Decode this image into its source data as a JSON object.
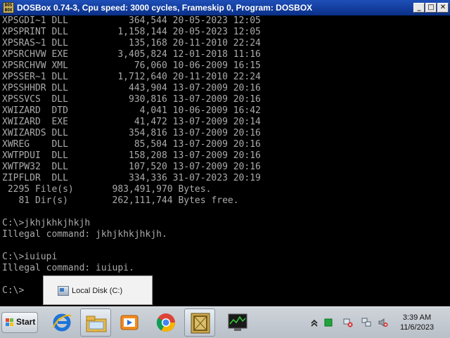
{
  "window": {
    "title": "DOSBox 0.74-3, Cpu speed:    3000 cycles, Frameskip  0, Program:   DOSBOX",
    "app_icon_text": "DOS BOX",
    "controls": {
      "minimize": "_",
      "maximize": "□",
      "close": "✕"
    }
  },
  "console": {
    "lines": [
      "XPSGDI~1 DLL           364,544 20-05-2023 12:05",
      "XPSPRINT DLL         1,158,144 20-05-2023 12:05",
      "XPSRAS~1 DLL           135,168 20-11-2010 22:24",
      "XPSRCHVW EXE         3,405,824 12-01-2018 11:16",
      "XPSRCHVW XML            76,060 10-06-2009 16:15",
      "XPSSER~1 DLL         1,712,640 20-11-2010 22:24",
      "XPSSHHDR DLL           443,904 13-07-2009 20:16",
      "XPSSVCS  DLL           930,816 13-07-2009 20:16",
      "XWIZARD  DTD             4,041 10-06-2009 16:42",
      "XWIZARD  EXE            41,472 13-07-2009 20:14",
      "XWIZARDS DLL           354,816 13-07-2009 20:16",
      "XWREG    DLL            85,504 13-07-2009 20:16",
      "XWTPDUI  DLL           158,208 13-07-2009 20:16",
      "XWTPW32  DLL           107,520 13-07-2009 20:16",
      "ZIPFLDR  DLL           334,336 31-07-2023 20:19",
      " 2295 File(s)       983,491,970 Bytes.",
      "   81 Dir(s)        262,111,744 Bytes free.",
      "",
      "C:\\>jkhjkhkjhkjh",
      "Illegal command: jkhjkhkjhkjh.",
      "",
      "C:\\>iuiupi",
      "Illegal command: iuiupi.",
      "",
      "C:\\>"
    ]
  },
  "popup": {
    "label": "Local Disk (C:)",
    "icon": "hard-drive-icon"
  },
  "taskbar": {
    "start_label": "Start",
    "buttons": [
      {
        "name": "internet-explorer",
        "icon": "internet-explorer-icon"
      },
      {
        "name": "windows-explorer",
        "icon": "folder-icon"
      },
      {
        "name": "media-player",
        "icon": "media-player-icon"
      },
      {
        "name": "chrome",
        "icon": "chrome-icon"
      },
      {
        "name": "dosbox",
        "icon": "dosbox-icon"
      },
      {
        "name": "task-manager",
        "icon": "task-manager-icon"
      }
    ]
  },
  "tray": {
    "time": "3:39 AM",
    "date": "11/6/2023",
    "icons": [
      "show-hidden-icons-icon",
      "green-status-icon",
      "network-warning-icon",
      "network-icon",
      "volume-muted-icon"
    ]
  },
  "colors": {
    "titlebar": "#1e4fb8",
    "console_bg": "#000000",
    "console_text": "#aaaaaa",
    "taskbar": "#c4cad1"
  }
}
